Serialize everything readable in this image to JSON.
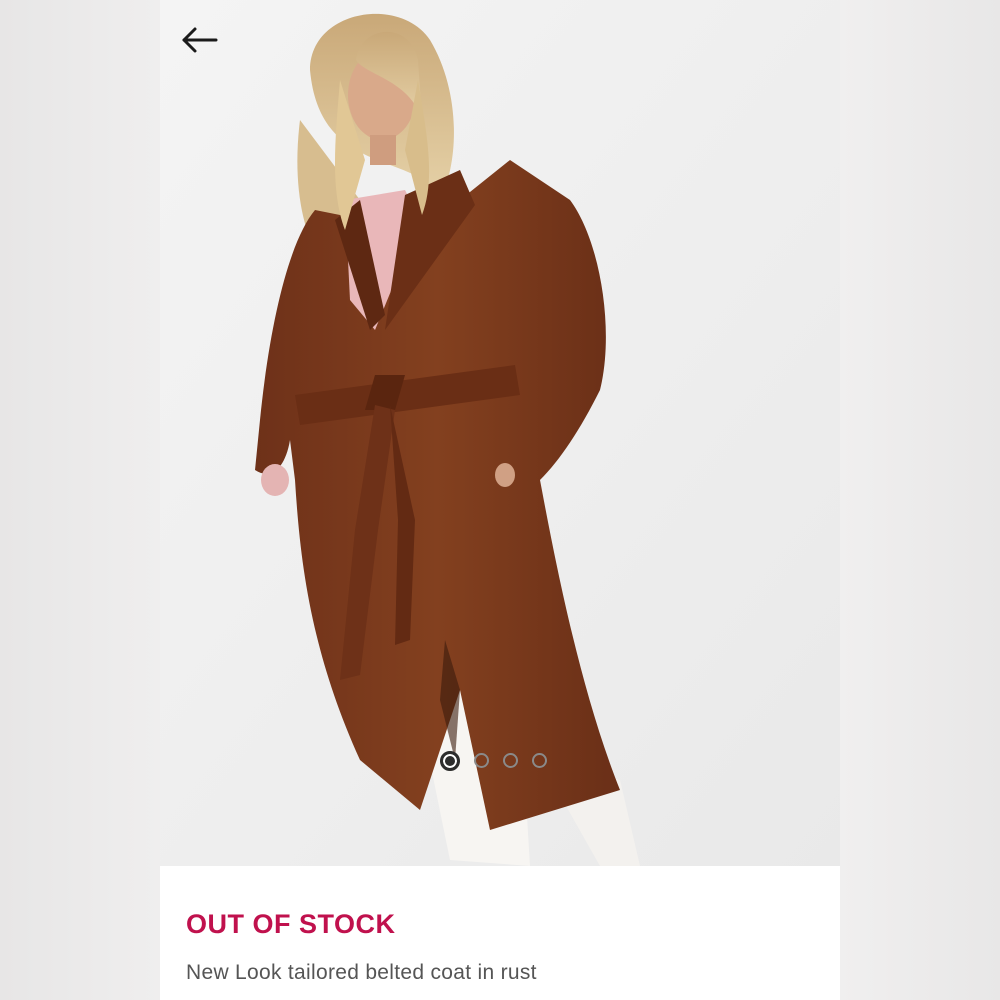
{
  "product": {
    "stock_status": "OUT OF STOCK",
    "title": "New Look tailored belted coat in rust"
  },
  "gallery": {
    "image_description": "model-wearing-rust-belted-coat",
    "total_images": 4,
    "active_index": 0
  },
  "navigation": {
    "back_icon": "arrow-left-icon"
  },
  "colors": {
    "stock_status": "#c0114d",
    "coat": "#7a3a1e",
    "background": "#efefef",
    "title_text": "#555555"
  }
}
